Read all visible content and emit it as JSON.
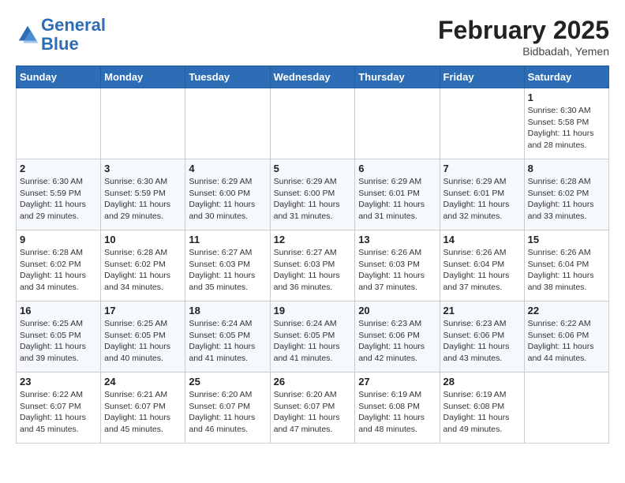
{
  "header": {
    "logo_line1": "General",
    "logo_line2": "Blue",
    "main_title": "February 2025",
    "subtitle": "Bidbadah, Yemen"
  },
  "weekdays": [
    "Sunday",
    "Monday",
    "Tuesday",
    "Wednesday",
    "Thursday",
    "Friday",
    "Saturday"
  ],
  "weeks": [
    [
      {
        "day": "",
        "info": ""
      },
      {
        "day": "",
        "info": ""
      },
      {
        "day": "",
        "info": ""
      },
      {
        "day": "",
        "info": ""
      },
      {
        "day": "",
        "info": ""
      },
      {
        "day": "",
        "info": ""
      },
      {
        "day": "1",
        "info": "Sunrise: 6:30 AM\nSunset: 5:58 PM\nDaylight: 11 hours and 28 minutes."
      }
    ],
    [
      {
        "day": "2",
        "info": "Sunrise: 6:30 AM\nSunset: 5:59 PM\nDaylight: 11 hours and 29 minutes."
      },
      {
        "day": "3",
        "info": "Sunrise: 6:30 AM\nSunset: 5:59 PM\nDaylight: 11 hours and 29 minutes."
      },
      {
        "day": "4",
        "info": "Sunrise: 6:29 AM\nSunset: 6:00 PM\nDaylight: 11 hours and 30 minutes."
      },
      {
        "day": "5",
        "info": "Sunrise: 6:29 AM\nSunset: 6:00 PM\nDaylight: 11 hours and 31 minutes."
      },
      {
        "day": "6",
        "info": "Sunrise: 6:29 AM\nSunset: 6:01 PM\nDaylight: 11 hours and 31 minutes."
      },
      {
        "day": "7",
        "info": "Sunrise: 6:29 AM\nSunset: 6:01 PM\nDaylight: 11 hours and 32 minutes."
      },
      {
        "day": "8",
        "info": "Sunrise: 6:28 AM\nSunset: 6:02 PM\nDaylight: 11 hours and 33 minutes."
      }
    ],
    [
      {
        "day": "9",
        "info": "Sunrise: 6:28 AM\nSunset: 6:02 PM\nDaylight: 11 hours and 34 minutes."
      },
      {
        "day": "10",
        "info": "Sunrise: 6:28 AM\nSunset: 6:02 PM\nDaylight: 11 hours and 34 minutes."
      },
      {
        "day": "11",
        "info": "Sunrise: 6:27 AM\nSunset: 6:03 PM\nDaylight: 11 hours and 35 minutes."
      },
      {
        "day": "12",
        "info": "Sunrise: 6:27 AM\nSunset: 6:03 PM\nDaylight: 11 hours and 36 minutes."
      },
      {
        "day": "13",
        "info": "Sunrise: 6:26 AM\nSunset: 6:03 PM\nDaylight: 11 hours and 37 minutes."
      },
      {
        "day": "14",
        "info": "Sunrise: 6:26 AM\nSunset: 6:04 PM\nDaylight: 11 hours and 37 minutes."
      },
      {
        "day": "15",
        "info": "Sunrise: 6:26 AM\nSunset: 6:04 PM\nDaylight: 11 hours and 38 minutes."
      }
    ],
    [
      {
        "day": "16",
        "info": "Sunrise: 6:25 AM\nSunset: 6:05 PM\nDaylight: 11 hours and 39 minutes."
      },
      {
        "day": "17",
        "info": "Sunrise: 6:25 AM\nSunset: 6:05 PM\nDaylight: 11 hours and 40 minutes."
      },
      {
        "day": "18",
        "info": "Sunrise: 6:24 AM\nSunset: 6:05 PM\nDaylight: 11 hours and 41 minutes."
      },
      {
        "day": "19",
        "info": "Sunrise: 6:24 AM\nSunset: 6:05 PM\nDaylight: 11 hours and 41 minutes."
      },
      {
        "day": "20",
        "info": "Sunrise: 6:23 AM\nSunset: 6:06 PM\nDaylight: 11 hours and 42 minutes."
      },
      {
        "day": "21",
        "info": "Sunrise: 6:23 AM\nSunset: 6:06 PM\nDaylight: 11 hours and 43 minutes."
      },
      {
        "day": "22",
        "info": "Sunrise: 6:22 AM\nSunset: 6:06 PM\nDaylight: 11 hours and 44 minutes."
      }
    ],
    [
      {
        "day": "23",
        "info": "Sunrise: 6:22 AM\nSunset: 6:07 PM\nDaylight: 11 hours and 45 minutes."
      },
      {
        "day": "24",
        "info": "Sunrise: 6:21 AM\nSunset: 6:07 PM\nDaylight: 11 hours and 45 minutes."
      },
      {
        "day": "25",
        "info": "Sunrise: 6:20 AM\nSunset: 6:07 PM\nDaylight: 11 hours and 46 minutes."
      },
      {
        "day": "26",
        "info": "Sunrise: 6:20 AM\nSunset: 6:07 PM\nDaylight: 11 hours and 47 minutes."
      },
      {
        "day": "27",
        "info": "Sunrise: 6:19 AM\nSunset: 6:08 PM\nDaylight: 11 hours and 48 minutes."
      },
      {
        "day": "28",
        "info": "Sunrise: 6:19 AM\nSunset: 6:08 PM\nDaylight: 11 hours and 49 minutes."
      },
      {
        "day": "",
        "info": ""
      }
    ]
  ]
}
